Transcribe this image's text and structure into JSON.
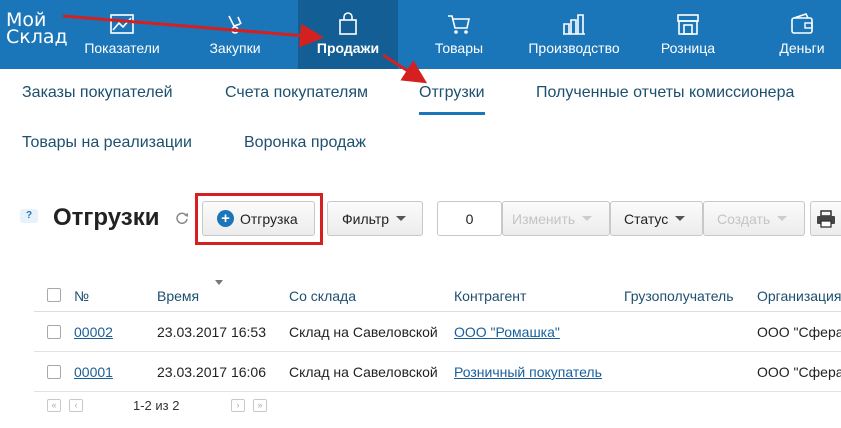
{
  "brand": {
    "logo_line1": "Мой",
    "logo_line2": "Склад"
  },
  "nav": [
    {
      "label": "Показатели",
      "icon": "chart-icon"
    },
    {
      "label": "Закупки",
      "icon": "purchases-icon"
    },
    {
      "label": "Продажи",
      "icon": "shopping-bag-icon",
      "active": true
    },
    {
      "label": "Товары",
      "icon": "cart-icon"
    },
    {
      "label": "Производство",
      "icon": "factory-icon"
    },
    {
      "label": "Розница",
      "icon": "store-icon"
    },
    {
      "label": "Деньги",
      "icon": "wallet-icon"
    }
  ],
  "sub_tabs": [
    {
      "label": "Заказы покупателей"
    },
    {
      "label": "Счета покупателям"
    },
    {
      "label": "Отгрузки",
      "active": true
    },
    {
      "label": "Полученные отчеты комиссионера"
    },
    {
      "label": "Товары на реализации"
    },
    {
      "label": "Воронка продаж"
    }
  ],
  "toolbar": {
    "help": "?",
    "title": "Отгрузки",
    "add_label": "Отгрузка",
    "filter_label": "Фильтр",
    "count_value": "0",
    "edit_label": "Изменить",
    "status_label": "Статус",
    "create_label": "Создать"
  },
  "table": {
    "columns": [
      "№",
      "Время",
      "Со склада",
      "Контрагент",
      "Грузополучатель",
      "Организация"
    ],
    "rows": [
      {
        "number": "00002",
        "time": "23.03.2017 16:53",
        "warehouse": "Склад на Савеловской",
        "counterparty": "ООО \"Ромашка\"",
        "consignee": "",
        "organization": "ООО \"Сфера\""
      },
      {
        "number": "00001",
        "time": "23.03.2017 16:06",
        "warehouse": "Склад на Савеловской",
        "counterparty": "Розничный покупатель",
        "consignee": "",
        "organization": "ООО \"Сфера\""
      }
    ]
  },
  "pager": {
    "range_text": "1-2 из 2",
    "first": "«",
    "prev": "‹",
    "next": "›",
    "last": "»"
  },
  "colors": {
    "header_bg": "#1a76b8",
    "header_active": "#135f95",
    "annotation_red": "#d61f1f"
  }
}
